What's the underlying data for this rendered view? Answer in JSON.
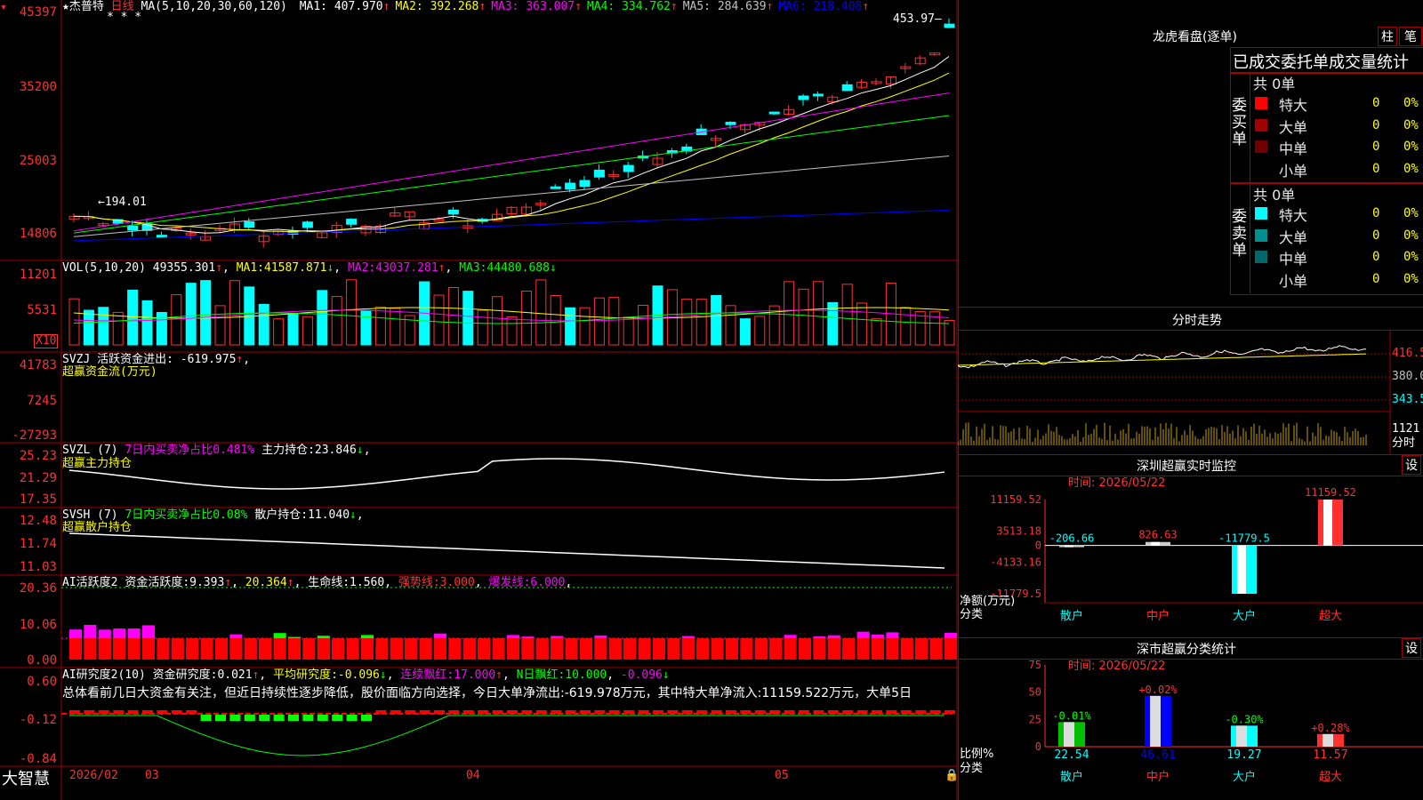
{
  "stock": {
    "name": "★杰普特",
    "period": "日线",
    "ma_header": "MA(5,10,20,30,60,120)",
    "ma_values": [
      {
        "label": "MA1:",
        "value": "407.970",
        "color": "#ffffff"
      },
      {
        "label": "MA2:",
        "value": "392.268",
        "color": "#ffff00"
      },
      {
        "label": "MA3:",
        "value": "363.007",
        "color": "#ff00ff"
      },
      {
        "label": "MA4:",
        "value": "334.762",
        "color": "#00ff00"
      },
      {
        "label": "MA5:",
        "value": "284.639",
        "color": "#c0c0c0"
      },
      {
        "label": "MA6:",
        "value": "218.408",
        "color": "#0000ff"
      }
    ],
    "high_label": "453.97",
    "low_label": "194.01",
    "stars": "* * *"
  },
  "price_axis": [
    "45397",
    "35200",
    "25003",
    "14806"
  ],
  "vol": {
    "header": "VOL(5,10,20)",
    "value": "49355.301",
    "ma1": "41587.871",
    "ma2": "43037.281",
    "ma3": "44480.688",
    "axis": [
      "11201",
      "5531"
    ],
    "multiplier": "X10"
  },
  "svzj": {
    "title": "SVZJ",
    "label": "活跃资金进出:",
    "value": "-619.975",
    "subtitle": "超赢资金流(万元)",
    "axis": [
      "41783",
      "7245",
      "-27293"
    ]
  },
  "svzl": {
    "title": "SVZL",
    "param": "(7)",
    "ratio": "7日内买卖净占比0.481%",
    "hold_label": "主力持仓:",
    "hold_value": "23.846",
    "subtitle": "超赢主力持仓",
    "axis": [
      "25.23",
      "21.29",
      "17.35"
    ]
  },
  "svsh": {
    "title": "SVSH",
    "param": "(7)",
    "ratio": "7日内买卖净占比0.08%",
    "hold_label": "散户持仓:",
    "hold_value": "11.040",
    "subtitle": "超赢散户持仓",
    "axis": [
      "12.48",
      "11.74",
      "11.03"
    ]
  },
  "ai_active": {
    "title": "AI活跃度2",
    "label": "资金活跃度:",
    "value": "9.393",
    "v2": "20.364",
    "life_label": "生命线:",
    "life_value": "1.560",
    "strong_label": "强势线:",
    "strong_value": "3.000",
    "burst_label": "爆发线:",
    "burst_value": "6.000",
    "axis": [
      "20.36",
      "10.06",
      "0.00"
    ]
  },
  "ai_research": {
    "title": "AI研究度2(10)",
    "label": "资金研究度:",
    "value": "0.021",
    "avg_label": "平均研究度:",
    "avg_value": "-0.096",
    "red_label": "连续飘红:",
    "red_value": "17.000",
    "n_label": "N日飘红:",
    "n_value": "10.000",
    "last_value": "-0.096",
    "summary": "总体看前几日大资金有关注，但近日持续性逐步降低，股价面临方向选择，今日大单净流出:-619.978万元，其中特大单净流入:11159.522万元，大单5日",
    "axis": [
      "0.60",
      "-0.12",
      "-0.84"
    ]
  },
  "footer": {
    "brand": "大智慧",
    "dates": [
      "2026/02",
      "03",
      "04",
      "05"
    ]
  },
  "dragon": {
    "title": "龙虎看盘(逐单)",
    "btn1": "柱",
    "btn2": "笔",
    "tabs": "已成交委托单成交量统计",
    "buy_label": "委买单",
    "sell_label": "委卖单",
    "buy_total": "共 0单",
    "sell_total": "共 0单",
    "buy_rows": [
      {
        "name": "特大",
        "count": "0",
        "pct": "0%",
        "color": "#ff0000"
      },
      {
        "name": "大单",
        "count": "0",
        "pct": "0%",
        "color": "#a00000"
      },
      {
        "name": "中单",
        "count": "0",
        "pct": "0%",
        "color": "#700000"
      },
      {
        "name": "小单",
        "count": "0",
        "pct": "0%",
        "color": "#000000"
      }
    ],
    "sell_rows": [
      {
        "name": "特大",
        "count": "0",
        "pct": "0%",
        "color": "#00ffff"
      },
      {
        "name": "大单",
        "count": "0",
        "pct": "0%",
        "color": "#009090"
      },
      {
        "name": "中单",
        "count": "0",
        "pct": "0%",
        "color": "#006868"
      },
      {
        "name": "小单",
        "count": "0",
        "pct": "0%",
        "color": "#000000"
      }
    ]
  },
  "intraday": {
    "title": "分时走势",
    "axis": [
      "416.5",
      "380.0",
      "343.5"
    ],
    "vol_label": "1121",
    "vol_unit": "分时"
  },
  "sz_monitor": {
    "title": "深圳超赢实时监控",
    "btn": "设",
    "time": "时间: 2026/05/22",
    "axis": [
      "11159.52",
      "3513.18",
      "0",
      "-4133.16",
      "-11779.5"
    ],
    "unit": "净额(万元)",
    "cat_label": "分类",
    "chart_data": {
      "type": "bar",
      "categories": [
        "散户",
        "中户",
        "大户",
        "超大"
      ],
      "values": [
        -206.66,
        826.63,
        -11779.5,
        11159.52
      ],
      "labels": [
        "-206.66",
        "826.63",
        "-11779.5",
        "11159.52"
      ],
      "ylim": [
        -11779.5,
        11159.52
      ]
    }
  },
  "sz_stats": {
    "title": "深市超赢分类统计",
    "btn": "设",
    "time": "时间: 2026/05/22",
    "axis": [
      "75",
      "50",
      "25",
      "0"
    ],
    "unit": "比例%",
    "cat_label": "分类",
    "chart_data": {
      "type": "bar",
      "categories": [
        "散户",
        "中户",
        "大户",
        "超大"
      ],
      "values": [
        22.54,
        46.61,
        19.27,
        11.57
      ],
      "changes": [
        "-0.01%",
        "+0.02%",
        "-0.30%",
        "+0.28%"
      ],
      "ylim": [
        0,
        75
      ]
    }
  }
}
